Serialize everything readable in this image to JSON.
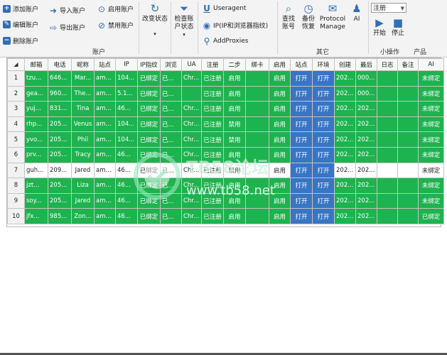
{
  "ribbon": {
    "account": {
      "add": "添加账户",
      "edit": "编辑账户",
      "delete": "删除账户",
      "import": "导入账户",
      "export": "导出账户",
      "enable": "启用账户",
      "disable": "禁用账户",
      "group_label": "账户"
    },
    "change_status": "改变状态",
    "check_status": "检查账户状态",
    "useragent": "Useragent",
    "ip_fingerprint": "IP(IP和浏览器指纹)",
    "add_proxies": "AddProxies",
    "find_account": "查找账号",
    "backup_restore": "备份恢复",
    "protocol_manage": "Protocol Manage",
    "ai": "AI",
    "other_group_label": "其它",
    "combo_value": "注册",
    "start": "开始",
    "stop": "停止",
    "small_ops_label": "小操作",
    "product_label": "产品"
  },
  "table": {
    "columns": [
      "",
      "邮箱",
      "电话",
      "昵称",
      "站点",
      "IP",
      "IP指纹",
      "浏览",
      "UA",
      "注册",
      "二步",
      "绑卡",
      "启用",
      "站点",
      "环境",
      "创建",
      "最后",
      "日志",
      "备注",
      "AI"
    ],
    "rows": [
      {
        "n": "1",
        "email": "tzu...",
        "phone": "646...",
        "nick": "Mar...",
        "site": "ama...",
        "ip": "104...",
        "ipfp": "已绑定",
        "browser": "已绑定",
        "ua": "Chr...",
        "reg": "已注册",
        "two": "启用",
        "card": "",
        "enabled": "启用",
        "site_btn": "打开",
        "env_btn": "打开",
        "created": "202...",
        "last": "000...",
        "log": "",
        "note": "",
        "ai": "未绑定",
        "style": "g"
      },
      {
        "n": "2",
        "email": "gea...",
        "phone": "960...",
        "nick": "The...",
        "site": "ama...",
        "ip": "5.1...",
        "ipfp": "已绑定",
        "browser": "已绑定",
        "ua": "",
        "reg": "已注册",
        "two": "启用",
        "card": "",
        "enabled": "启用",
        "site_btn": "打开",
        "env_btn": "打开",
        "created": "202...",
        "last": "000...",
        "log": "",
        "note": "",
        "ai": "未绑定",
        "style": "g"
      },
      {
        "n": "3",
        "email": "yuj...",
        "phone": "831...",
        "nick": "Tina",
        "site": "ama...",
        "ip": "46...",
        "ipfp": "已绑定",
        "browser": "已绑定",
        "ua": "Chr...",
        "reg": "已注册",
        "two": "启用",
        "card": "",
        "enabled": "启用",
        "site_btn": "打开",
        "env_btn": "打开",
        "created": "202...",
        "last": "202...",
        "log": "",
        "note": "",
        "ai": "未绑定",
        "style": "g"
      },
      {
        "n": "4",
        "email": "rhp...",
        "phone": "205...",
        "nick": "Venus",
        "site": "ama...",
        "ip": "104...",
        "ipfp": "已绑定",
        "browser": "已绑定",
        "ua": "Chr...",
        "reg": "已注册",
        "two": "禁用",
        "card": "",
        "enabled": "启用",
        "site_btn": "打开",
        "env_btn": "打开",
        "created": "202...",
        "last": "202...",
        "log": "",
        "note": "",
        "ai": "未绑定",
        "style": "g"
      },
      {
        "n": "5",
        "email": "yvo...",
        "phone": "205...",
        "nick": "Phil",
        "site": "ama...",
        "ip": "104...",
        "ipfp": "已绑定",
        "browser": "已绑定",
        "ua": "Chr...",
        "reg": "已注册",
        "two": "禁用",
        "card": "",
        "enabled": "启用",
        "site_btn": "打开",
        "env_btn": "打开",
        "created": "202...",
        "last": "202...",
        "log": "",
        "note": "",
        "ai": "未绑定",
        "style": "g"
      },
      {
        "n": "6",
        "email": "prv...",
        "phone": "205...",
        "nick": "Tracy",
        "site": "ama...",
        "ip": "46...",
        "ipfp": "已绑定",
        "browser": "已绑定",
        "ua": "Chr...",
        "reg": "已注册",
        "two": "启用",
        "card": "",
        "enabled": "启用",
        "site_btn": "打开",
        "env_btn": "打开",
        "created": "202...",
        "last": "202...",
        "log": "",
        "note": "",
        "ai": "未绑定",
        "style": "g"
      },
      {
        "n": "7",
        "email": "guh...",
        "phone": "209...",
        "nick": "Jared",
        "site": "ama...",
        "ip": "46...",
        "ipfp": "已绑定",
        "browser": "已绑定",
        "ua": "Chr...",
        "reg": "已注册",
        "two": "禁用",
        "card": "",
        "enabled": "启用",
        "site_btn": "打开",
        "env_btn": "打开",
        "created": "202...",
        "last": "202...",
        "log": "",
        "note": "",
        "ai": "未绑定",
        "style": "w"
      },
      {
        "n": "8",
        "email": "jzt...",
        "phone": "205...",
        "nick": "Liza",
        "site": "ama...",
        "ip": "46...",
        "ipfp": "已绑定",
        "browser": "已绑定",
        "ua": "Chr...",
        "reg": "已注册",
        "two": "启用",
        "card": "",
        "enabled": "启用",
        "site_btn": "打开",
        "env_btn": "打开",
        "created": "202...",
        "last": "202...",
        "log": "",
        "note": "",
        "ai": "未绑定",
        "style": "g"
      },
      {
        "n": "9",
        "email": "soy...",
        "phone": "205...",
        "nick": "Jared",
        "site": "ama...",
        "ip": "46...",
        "ipfp": "已绑定",
        "browser": "已绑定",
        "ua": "Chr...",
        "reg": "已注册",
        "two": "启用",
        "card": "",
        "enabled": "启用",
        "site_btn": "打开",
        "env_btn": "打开",
        "created": "202...",
        "last": "202...",
        "log": "",
        "note": "",
        "ai": "未绑定",
        "style": "g"
      },
      {
        "n": "10",
        "email": "jfx...",
        "phone": "985...",
        "nick": "Zon...",
        "site": "ama...",
        "ip": "46...",
        "ipfp": "已绑定",
        "browser": "已绑定",
        "ua": "Chr...",
        "reg": "已注册",
        "two": "启用",
        "card": "",
        "enabled": "启用",
        "site_btn": "打开",
        "env_btn": "打开",
        "created": "202...",
        "last": "202...",
        "log": "",
        "note": "",
        "ai": "已绑定",
        "style": "g"
      }
    ]
  },
  "watermark": {
    "logo_text": "TB58论坛",
    "url_text": "www.tb58.net"
  },
  "colors": {
    "row_green": "#1db34e",
    "open_blue": "#3875c5",
    "accent_blue": "#2f6fb7"
  }
}
